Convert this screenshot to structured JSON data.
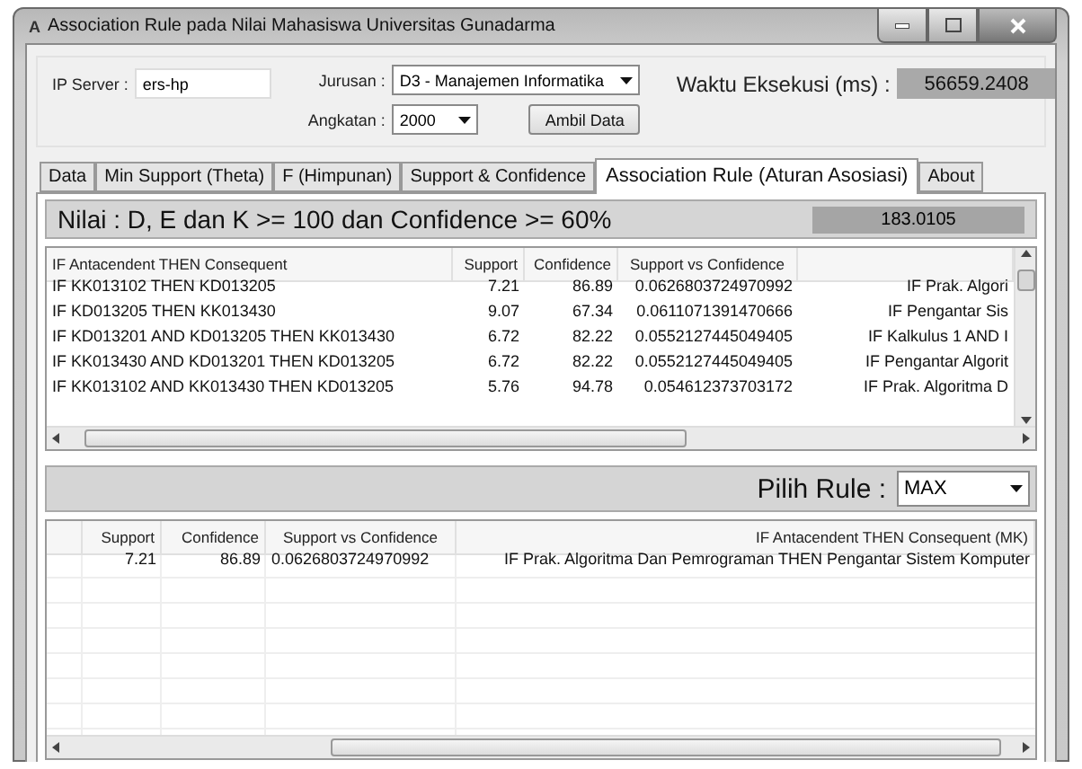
{
  "window": {
    "title": "Association Rule pada Nilai Mahasiswa Universitas Gunadarma",
    "app_icon": "A"
  },
  "form": {
    "ip_label": "IP Server :",
    "ip_value": "ers-hp",
    "jurusan_label": "Jurusan :",
    "jurusan_value": "D3 - Manajemen Informatika",
    "angkatan_label": "Angkatan :",
    "angkatan_value": "2000",
    "fetch_button": "Ambil Data",
    "time_label": "Waktu Eksekusi (ms) :",
    "time_value": "56659.2408"
  },
  "tabs": [
    {
      "label": "Data",
      "selected": false
    },
    {
      "label": "Min Support (Theta)",
      "selected": false
    },
    {
      "label": "F (Himpunan)",
      "selected": false
    },
    {
      "label": "Support & Confidence",
      "selected": false
    },
    {
      "label": "Association Rule (Aturan Asosiasi)",
      "selected": true
    },
    {
      "label": "About",
      "selected": false
    }
  ],
  "panel": {
    "title": "Nilai : D, E dan K >= 100 dan Confidence >= 60%",
    "value": "183.0105"
  },
  "rules_table": {
    "columns": [
      "IF Antacendent THEN Consequent",
      "Support",
      "Confidence",
      "Support vs Confidence"
    ],
    "rows": [
      {
        "rule": "IF KK013102 THEN KD013205",
        "support": "7.21",
        "confidence": "86.89",
        "support_vs_confidence": "0.0626803724970992",
        "column_5": "IF Prak. Algori"
      },
      {
        "rule": "IF KD013205 THEN KK013430",
        "support": "9.07",
        "confidence": "67.34",
        "support_vs_confidence": "0.0611071391470666",
        "column_5": "IF Pengantar Sis"
      },
      {
        "rule": "IF KD013201 AND KD013205 THEN KK013430",
        "support": "6.72",
        "confidence": "82.22",
        "support_vs_confidence": "0.0552127445049405",
        "column_5": "IF Kalkulus 1 AND I"
      },
      {
        "rule": "IF KK013430 AND KD013201 THEN KD013205",
        "support": "6.72",
        "confidence": "82.22",
        "support_vs_confidence": "0.0552127445049405",
        "column_5": "IF Pengantar Algorit"
      },
      {
        "rule": "IF KK013102 AND KK013430 THEN KD013205",
        "support": "5.76",
        "confidence": "94.78",
        "support_vs_confidence": "0.054612373703172",
        "column_5": "IF Prak. Algoritma D"
      }
    ]
  },
  "rule_picker": {
    "label": "Pilih Rule :",
    "value": "MAX"
  },
  "result_table": {
    "columns": [
      "Support",
      "Confidence",
      "Support vs Confidence",
      "IF Antacendent THEN Consequent (MK)"
    ],
    "rows": [
      {
        "support": "7.21",
        "confidence": "86.89",
        "support_vs_confidence": "0.0626803724970992",
        "rule": "IF Prak. Algoritma Dan Pemrograman THEN Pengantar Sistem Komputer"
      }
    ]
  }
}
